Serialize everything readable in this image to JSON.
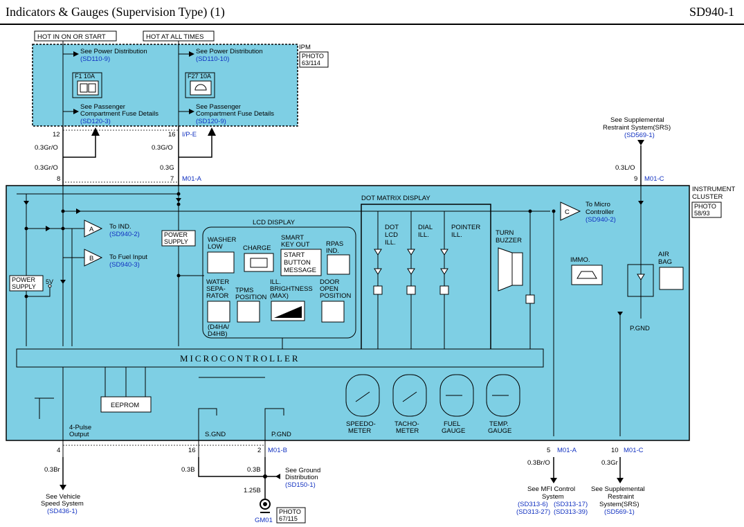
{
  "header": {
    "title": "Indicators & Gauges (Supervision Type) (1)",
    "code": "SD940-1"
  },
  "colors": {
    "module_fill": "#7ecfe4",
    "ref_text": "#1030c0",
    "line": "#000000"
  },
  "tags": {
    "hot_run_start": "HOT IN ON OR START",
    "hot_all": "HOT AT ALL TIMES"
  },
  "ipm": {
    "name": "IPM",
    "photo": "PHOTO",
    "photo_ref": "63/114",
    "left": {
      "see1": "See Power Distribution",
      "ref1": "(SD110-9)",
      "fuse": "F1 10A",
      "see2a": "See Passenger",
      "see2b": "Compartment Fuse Details",
      "ref2": "(SD120-3)"
    },
    "right": {
      "see1": "See Power Distribution",
      "ref1": "(SD110-10)",
      "fuse": "F27 10A",
      "see2a": "See Passenger",
      "see2b": "Compartment Fuse Details",
      "ref2": "(SD120-9)"
    }
  },
  "top_pins": {
    "p12": "12",
    "p16": "16",
    "ipe": "I/P-E",
    "p8": "8",
    "p7": "7",
    "m01a": "M01-A",
    "p9": "9",
    "m01c": "M01-C"
  },
  "wires": {
    "w1": "0.3Gr/O",
    "w2": "0.3Gr/O",
    "w3": "0.3G/O",
    "w4": "0.3G",
    "w5": "0.3L/O",
    "w6": "0.3Br",
    "w7": "0.3B",
    "w8": "0.3B",
    "w9": "1.25B",
    "w10": "0.3Br/O",
    "w11": "0.3Gr"
  },
  "srs_top": {
    "l1": "See Supplemental",
    "l2": "Restraint System(SRS)",
    "ref": "(SD569-1)"
  },
  "cluster": {
    "l1": "INSTRUMENT",
    "l2": "CLUSTER",
    "photo": "PHOTO",
    "photo_ref": "58/93"
  },
  "inside": {
    "to_ind": "To IND.",
    "to_ind_ref": "(SD940-2)",
    "a": "A",
    "to_fuel": "To Fuel Input",
    "to_fuel_ref": "(SD940-3)",
    "b": "B",
    "ps1a": "POWER",
    "ps1b": "SUPPLY",
    "v5": "5V",
    "ps2a": "POWER",
    "ps2b": "SUPPLY",
    "c": "C",
    "to_micro1": "To Micro",
    "to_micro2": "Controller",
    "to_micro_ref": "(SD940-2)",
    "pulse1": "4-Pulse",
    "pulse2": "Output",
    "sgnd": "S.GND",
    "pgnd": "P.GND",
    "eeprom": "EEPROM",
    "micro": "MICROCONTROLLER"
  },
  "lcd": {
    "title": "LCD DISPLAY",
    "washer1": "WASHER",
    "washer2": "LOW",
    "charge": "CHARGE",
    "smart1": "SMART",
    "smart2": "KEY OUT",
    "start1": "START",
    "start2": "BUTTON",
    "start3": "MESSAGE",
    "rpas1": "RPAS",
    "rpas2": "IND.",
    "water1": "WATER",
    "water2": "SEPA-",
    "water3": "RATOR",
    "water4": "(D4HA/",
    "water5": "D4HB)",
    "tpms1": "TPMS",
    "tpms2": "POSITION",
    "ill1": "ILL.",
    "ill2": "BRIGHTNESS",
    "ill3": "(MAX)",
    "door1": "DOOR",
    "door2": "OPEN",
    "door3": "POSITION"
  },
  "dot_matrix": {
    "title": "DOT MATRIX DISPLAY",
    "dot1": "DOT",
    "dot2": "LCD",
    "dot3": "ILL.",
    "dial1": "DIAL",
    "dial2": "ILL.",
    "ptr1": "POINTER",
    "ptr2": "ILL."
  },
  "misc": {
    "turn1": "TURN",
    "turn2": "BUZZER",
    "immo": "IMMO.",
    "air1": "AIR",
    "air2": "BAG",
    "pgnd_r": "P.GND"
  },
  "gauges": {
    "speedo1": "SPEEDO-",
    "speedo2": "METER",
    "tacho1": "TACHO-",
    "tacho2": "METER",
    "fuel1": "FUEL",
    "fuel2": "GAUGE",
    "temp1": "TEMP.",
    "temp2": "GAUGE"
  },
  "bottom": {
    "p4": "4",
    "p16": "16",
    "p2": "2",
    "m01b": "M01-B",
    "p5": "5",
    "m01a": "M01-A",
    "p10": "10",
    "m01c": "M01-C",
    "vss1": "See Vehicle",
    "vss2": "Speed System",
    "vss_ref": "(SD436-1)",
    "gd1": "See Ground",
    "gd2": "Distribution",
    "gd_ref": "(SD150-1)",
    "gm01": "GM01",
    "photo": "PHOTO",
    "photo_ref": "67/115",
    "mfi1": "See MFI Control",
    "mfi2": "System",
    "mfi_ref1": "(SD313-6)",
    "mfi_ref2": "(SD313-17)",
    "mfi_ref3": "(SD313-27)",
    "mfi_ref4": "(SD313-39)",
    "srs1": "See Supplemental",
    "srs2": "Restraint",
    "srs3": "System(SRS)",
    "srs_ref": "(SD569-1)"
  }
}
